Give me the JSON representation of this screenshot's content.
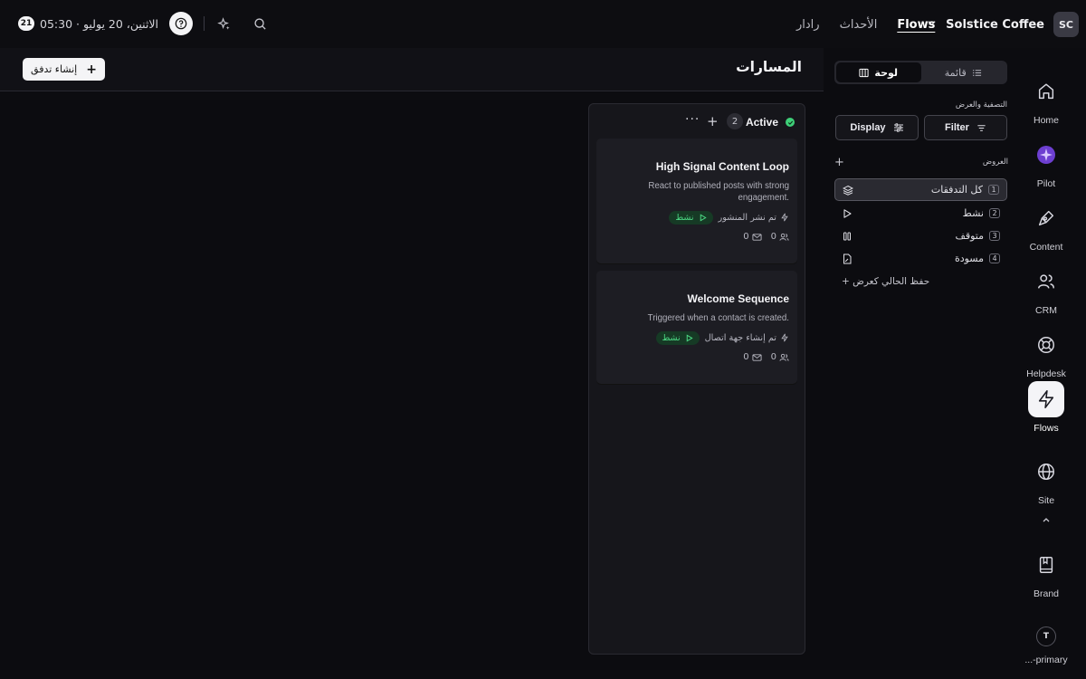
{
  "topbar": {
    "brand_avatar": "SC",
    "brand_name": "Solstice Coffee",
    "nav": [
      "Flows",
      "الأحداث",
      "رادار"
    ],
    "date_badge": "21",
    "datetime": "الاثنين، 20 يوليو · 05:30"
  },
  "rail": {
    "items": [
      {
        "label": "Home",
        "icon": "home-icon"
      },
      {
        "label": "Pilot",
        "icon": "pilot-icon"
      },
      {
        "label": "Content",
        "icon": "pen-icon"
      },
      {
        "label": "CRM",
        "icon": "users-icon"
      },
      {
        "label": "Helpdesk",
        "icon": "lifebuoy-icon"
      },
      {
        "label": "Flows",
        "icon": "lightning-icon"
      },
      {
        "label": "Site",
        "icon": "globe-icon"
      },
      {
        "label": "Brand",
        "icon": "book-icon"
      },
      {
        "label": "...-primary",
        "avatar": "T"
      }
    ]
  },
  "sidebar": {
    "toggle": {
      "list": "قائمة",
      "board": "لوحة"
    },
    "filter_section": "التصفية والعرض",
    "filter_label": "Filter",
    "display_label": "Display",
    "views_label": "العروض",
    "views": [
      {
        "label": "كل التدفقات",
        "count": "1"
      },
      {
        "label": "نشط",
        "count": "2"
      },
      {
        "label": "متوقف",
        "count": "3"
      },
      {
        "label": "مسودة",
        "count": "4"
      }
    ],
    "save_view": "+ حفظ الحالي كعرض"
  },
  "main": {
    "title": "المسارات",
    "create_label": "إنشاء تدفق",
    "column": {
      "title": "Active",
      "count": "2",
      "cards": [
        {
          "title": "High Signal Content Loop",
          "desc_line1": "React to published posts with strong",
          "desc_line2": "engagement.",
          "status": "نشط",
          "trigger": "تم نشر المنشور",
          "contacts": "0",
          "emails": "0"
        },
        {
          "title": "Welcome Sequence",
          "desc_line1": "Triggered when a contact is created.",
          "desc_line2": "",
          "status": "نشط",
          "trigger": "تم إنشاء جهة اتصال",
          "contacts": "0",
          "emails": "0"
        }
      ]
    }
  },
  "colors": {
    "accent_green": "#3ecf78",
    "pilot_purple": "#8b5cf6"
  }
}
